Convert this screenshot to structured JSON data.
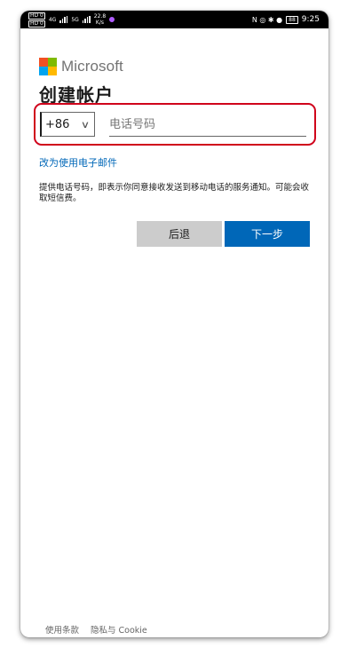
{
  "status_bar": {
    "chip_top": "HD 0",
    "chip_bottom": "HD 0",
    "net_4g": "4G",
    "net_5g": "5G",
    "speed_value": "22.8",
    "speed_unit": "K/s",
    "right_icons": "N ◎ ✱ ●",
    "battery": "88",
    "time": "9:25"
  },
  "brand": {
    "name": "Microsoft",
    "colors": [
      "#f25022",
      "#7fba00",
      "#00a4ef",
      "#ffb900"
    ]
  },
  "page": {
    "title": "创建帐户"
  },
  "form": {
    "country_code": "+86",
    "phone_placeholder": "电话号码",
    "use_email_link": "改为使用电子邮件",
    "notice": "提供电话号码，即表示你同意接收发送到移动电话的服务通知。可能会收取短信费。",
    "back_label": "后退",
    "next_label": "下一步"
  },
  "footer": {
    "terms": "使用条款",
    "privacy": "隐私与 Cookie"
  },
  "colors": {
    "accent": "#0067b8",
    "highlight": "#d0021b",
    "back_button": "#cccccc"
  }
}
